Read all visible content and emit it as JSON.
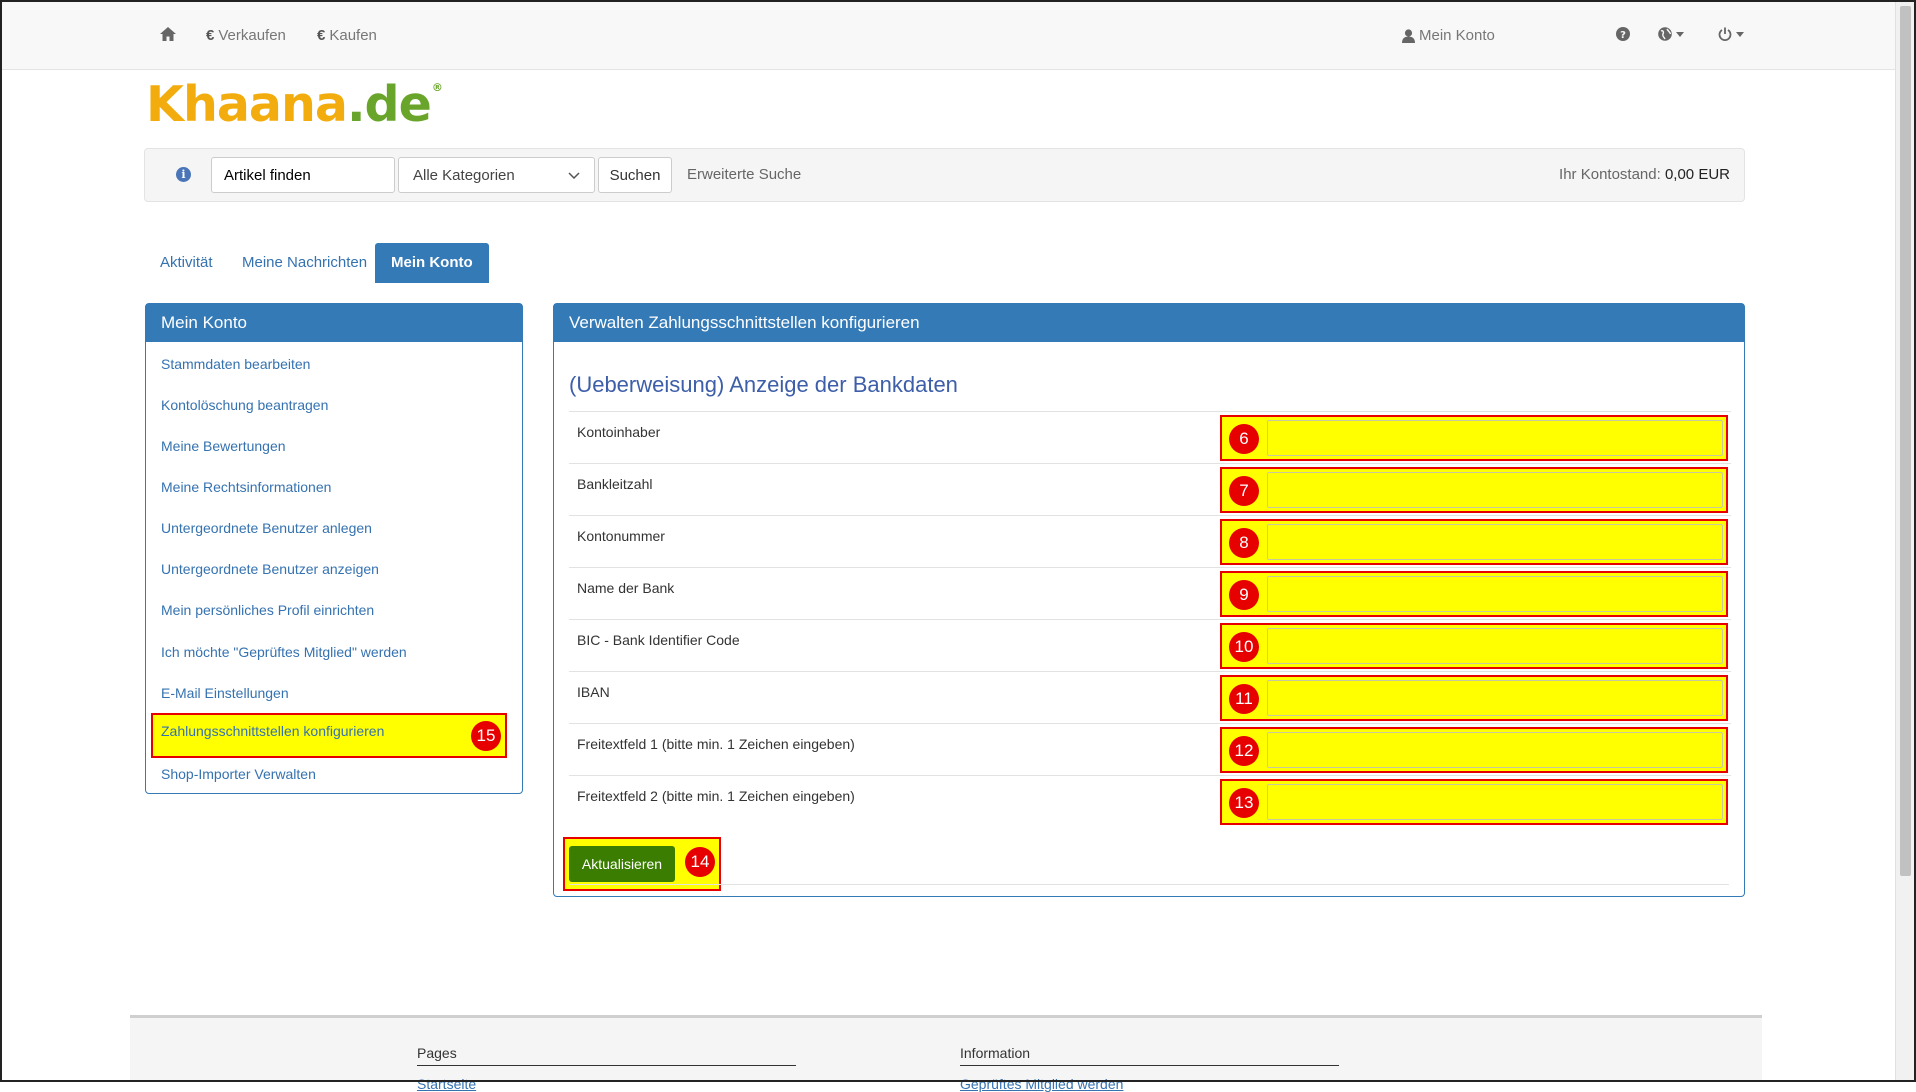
{
  "topnav": {
    "sell_label": "Verkaufen",
    "buy_label": "Kaufen",
    "account_label": "Mein Konto"
  },
  "logo": {
    "part1": "Khaana",
    "part2": ".de",
    "mark": "®"
  },
  "search": {
    "value": "Artikel finden",
    "category_selected": "Alle Kategorien",
    "button_label": "Suchen",
    "advanced_label": "Erweiterte Suche",
    "balance_label": "Ihr Kontostand:",
    "balance_value": "0,00 EUR"
  },
  "tabs": [
    {
      "label": "Aktivität"
    },
    {
      "label": "Meine Nachrichten"
    },
    {
      "label": "Mein Konto"
    }
  ],
  "sidebar": {
    "title": "Mein Konto",
    "items": [
      {
        "label": "Stammdaten bearbeiten"
      },
      {
        "label": "Kontolöschung beantragen"
      },
      {
        "label": "Meine Bewertungen"
      },
      {
        "label": "Meine Rechtsinformationen"
      },
      {
        "label": "Untergeordnete Benutzer anlegen"
      },
      {
        "label": "Untergeordnete Benutzer anzeigen"
      },
      {
        "label": "Mein persönliches Profil einrichten"
      },
      {
        "label": "Ich möchte \"Geprüftes Mitglied\" werden"
      },
      {
        "label": "E-Mail Einstellungen"
      },
      {
        "label": "Zahlungsschnittstellen konfigurieren",
        "badge": "15"
      },
      {
        "label": "Shop-Importer Verwalten"
      }
    ]
  },
  "main": {
    "header": "Verwalten Zahlungsschnittstellen konfigurieren",
    "section_title": "(Ueberweisung) Anzeige der Bankdaten",
    "fields": [
      {
        "label": "Kontoinhaber",
        "badge": "6",
        "value": ""
      },
      {
        "label": "Bankleitzahl",
        "badge": "7",
        "value": ""
      },
      {
        "label": "Kontonummer",
        "badge": "8",
        "value": ""
      },
      {
        "label": "Name der Bank",
        "badge": "9",
        "value": ""
      },
      {
        "label": "BIC - Bank Identifier Code",
        "badge": "10",
        "value": ""
      },
      {
        "label": "IBAN",
        "badge": "11",
        "value": ""
      },
      {
        "label": "Freitextfeld 1 (bitte min. 1 Zeichen eingeben)",
        "badge": "12",
        "value": ""
      },
      {
        "label": "Freitextfeld 2 (bitte min. 1 Zeichen eingeben)",
        "badge": "13",
        "value": ""
      }
    ],
    "update_label": "Aktualisieren",
    "update_badge": "14"
  },
  "footer": {
    "col1_title": "Pages",
    "col1_link": "Startseite",
    "col2_title": "Information",
    "col2_link": "Geprüftes Mitglied werden"
  },
  "colors": {
    "primary": "#337ab7",
    "highlight": "#ffff00",
    "marker": "#e60000",
    "button_green": "#3a7d00",
    "logo_orange": "#f2ac0d",
    "logo_green": "#6aa52b"
  }
}
